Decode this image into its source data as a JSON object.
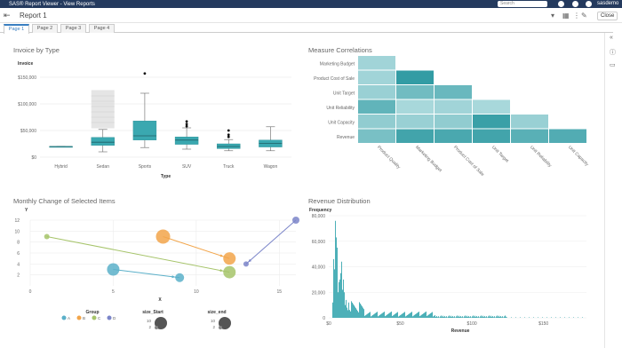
{
  "topbar": {
    "app_title": "SAS® Report Viewer - View Reports",
    "search_placeholder": "Search",
    "user": "sasdemo"
  },
  "report": {
    "title": "Report 1",
    "close_label": "Close"
  },
  "tabs": [
    "Page 1",
    "Page 2",
    "Page 3",
    "Page 4"
  ],
  "panels": {
    "invoice": {
      "title": "Invoice by Type"
    },
    "correlations": {
      "title": "Measure Correlations"
    },
    "monthly": {
      "title": "Monthly Change of Selected Items"
    },
    "revenue": {
      "title": "Revenue Distribution"
    }
  },
  "colors": {
    "teal": "#3aa8b0",
    "navbar": "#243a5e",
    "accent": "#3a7fc1"
  },
  "chart_data": [
    {
      "type": "box",
      "title": "Invoice by Type",
      "ylabel": "Invoice",
      "xlabel": "Type",
      "ylim": [
        0,
        170000
      ],
      "yticks": [
        "$0",
        "$50,000",
        "$100,000",
        "$150,000"
      ],
      "categories": [
        "Hybrid",
        "Sedan",
        "Sports",
        "SUV",
        "Truck",
        "Wagon"
      ],
      "boxes": [
        {
          "min": 20000,
          "q1": 20000,
          "median": 20000,
          "q3": 20000,
          "max": 20000,
          "outliers": []
        },
        {
          "min": 10000,
          "q1": 22000,
          "median": 28000,
          "q3": 37000,
          "max": 52000,
          "outliers": [
            60000,
            70000,
            80000,
            90000,
            100000,
            110000,
            120000
          ]
        },
        {
          "min": 18000,
          "q1": 32000,
          "median": 40000,
          "q3": 68000,
          "max": 120000,
          "outliers": [
            157000
          ]
        },
        {
          "min": 15000,
          "q1": 24000,
          "median": 32000,
          "q3": 38000,
          "max": 55000,
          "outliers": [
            58000,
            62000,
            67000
          ]
        },
        {
          "min": 12000,
          "q1": 16000,
          "median": 20000,
          "q3": 25000,
          "max": 33000,
          "outliers": [
            38000,
            42000,
            50000
          ]
        },
        {
          "min": 12000,
          "q1": 19000,
          "median": 26000,
          "q3": 32000,
          "max": 57000,
          "outliers": []
        }
      ]
    },
    {
      "type": "heatmap",
      "title": "Measure Correlations",
      "rows": [
        "Marketing Budget",
        "Product Cost of Sale",
        "Unit Target",
        "Unit Reliability",
        "Unit Capacity",
        "Revenue"
      ],
      "columns": [
        "Product Quality",
        "Marketing Budget",
        "Product Cost of Sale",
        "Unit Target",
        "Unit Reliability",
        "Unit Capacity"
      ],
      "values": [
        [
          0.25
        ],
        [
          0.25,
          0.95
        ],
        [
          0.3,
          0.55,
          0.6
        ],
        [
          0.65,
          0.2,
          0.25,
          0.2
        ],
        [
          0.35,
          0.3,
          0.35,
          0.9,
          0.3
        ],
        [
          0.5,
          0.85,
          0.8,
          0.85,
          0.7,
          0.75
        ]
      ]
    },
    {
      "type": "scatter",
      "title": "Monthly Change of Selected Items",
      "xlabel": "X",
      "ylabel": "Y",
      "xlim": [
        0,
        16
      ],
      "ylim": [
        0,
        12
      ],
      "xticks": [
        0,
        5,
        10,
        15
      ],
      "yticks": [
        2,
        4,
        6,
        8,
        10,
        12
      ],
      "legend": {
        "title": "Group",
        "items": [
          {
            "name": "A",
            "color": "#5bb0c9"
          },
          {
            "name": "B",
            "color": "#f2a54a"
          },
          {
            "name": "C",
            "color": "#a6c46a"
          },
          {
            "name": "D",
            "color": "#7b85c9"
          }
        ]
      },
      "size_legends": [
        {
          "title": "size_Start",
          "values": [
            10,
            2
          ]
        },
        {
          "title": "size_end",
          "values": [
            10,
            2
          ]
        }
      ],
      "series": [
        {
          "name": "A",
          "start": [
            5,
            3
          ],
          "end": [
            9,
            1.5
          ]
        },
        {
          "name": "B",
          "start": [
            8,
            9
          ],
          "end": [
            12,
            5
          ]
        },
        {
          "name": "C",
          "start": [
            1,
            9
          ],
          "end": [
            12,
            2.5
          ]
        },
        {
          "name": "D",
          "start": [
            16,
            12
          ],
          "end": [
            13,
            4
          ]
        }
      ]
    },
    {
      "type": "histogram",
      "title": "Revenue Distribution",
      "ylabel": "Frequency",
      "xlabel": "Revenue",
      "ylim": [
        0,
        80000
      ],
      "yticks": [
        "0",
        "20,000",
        "40,000",
        "60,000",
        "80,000"
      ],
      "xticks": [
        "$0",
        "$50",
        "$100",
        "$150"
      ],
      "xlim": [
        0,
        180
      ]
    }
  ]
}
